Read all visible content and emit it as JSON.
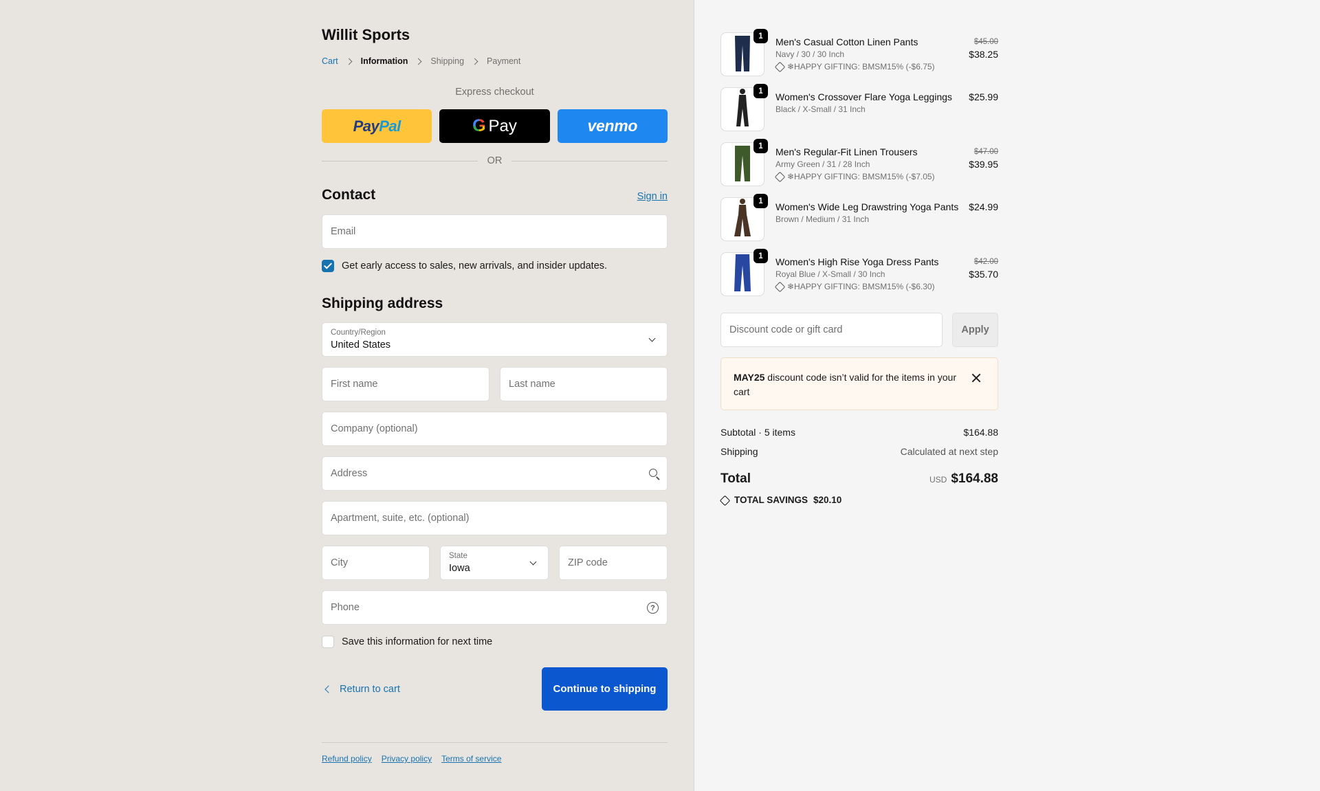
{
  "store": {
    "name": "Willit Sports"
  },
  "breadcrumb": [
    {
      "label": "Cart",
      "state": "link"
    },
    {
      "label": "Information",
      "state": "current"
    },
    {
      "label": "Shipping",
      "state": "upcoming"
    },
    {
      "label": "Payment",
      "state": "upcoming"
    }
  ],
  "express": {
    "label": "Express checkout",
    "buttons": [
      {
        "name": "paypal",
        "text_a": "Pay",
        "text_b": "Pal"
      },
      {
        "name": "gpay",
        "g": "G",
        "text": "Pay"
      },
      {
        "name": "venmo",
        "text": "venmo"
      }
    ],
    "or": "OR"
  },
  "contact": {
    "title": "Contact",
    "sign_in": "Sign in",
    "email_placeholder": "Email",
    "newsletter_label": "Get early access to sales, new arrivals, and insider updates.",
    "newsletter_checked": true
  },
  "shipping": {
    "title": "Shipping address",
    "country_label": "Country/Region",
    "country_value": "United States",
    "first_name": "First name",
    "last_name": "Last name",
    "company": "Company (optional)",
    "address": "Address",
    "apartment": "Apartment, suite, etc. (optional)",
    "city": "City",
    "state_label": "State",
    "state_value": "Iowa",
    "zip": "ZIP code",
    "phone": "Phone",
    "help_glyph": "?",
    "save_label": "Save this information for next time",
    "save_checked": false
  },
  "actions": {
    "return": "Return to cart",
    "continue": "Continue to shipping"
  },
  "footer": {
    "links": [
      "Refund policy",
      "Privacy policy",
      "Terms of service"
    ]
  },
  "cart": {
    "items": [
      {
        "name": "Men's Casual Cotton Linen Pants",
        "variant": "Navy / 30 / 30 Inch",
        "discount": "❄HAPPY GIFTING: BMSM15% (-$6.75)",
        "old_price": "$45.00",
        "price": "$38.25",
        "qty": "1",
        "color": "#1f2d4d"
      },
      {
        "name": "Women's Crossover Flare Yoga Leggings",
        "variant": "Black / X-Small / 31 Inch",
        "discount": "",
        "old_price": "",
        "price": "$25.99",
        "qty": "1",
        "color": "#222222"
      },
      {
        "name": "Men's Regular-Fit Linen Trousers",
        "variant": "Army Green / 31 / 28 Inch",
        "discount": "❄HAPPY GIFTING: BMSM15% (-$7.05)",
        "old_price": "$47.00",
        "price": "$39.95",
        "qty": "1",
        "color": "#3f5a2a"
      },
      {
        "name": "Women's Wide Leg Drawstring Yoga Pants",
        "variant": "Brown / Medium / 31 Inch",
        "discount": "",
        "old_price": "",
        "price": "$24.99",
        "qty": "1",
        "color": "#4a3426"
      },
      {
        "name": "Women's High Rise Yoga Dress Pants",
        "variant": "Royal Blue / X-Small / 30 Inch",
        "discount": "❄HAPPY GIFTING: BMSM15% (-$6.30)",
        "old_price": "$42.00",
        "price": "$35.70",
        "qty": "1",
        "color": "#2747a0"
      }
    ],
    "discount_placeholder": "Discount code or gift card",
    "apply": "Apply",
    "alert": {
      "code": "MAY25",
      "message": " discount code isn’t valid for the items in your cart"
    },
    "subtotal_label": "Subtotal · 5 items",
    "subtotal_value": "$164.88",
    "shipping_label": "Shipping",
    "shipping_value": "Calculated at next step",
    "total_label": "Total",
    "currency": "USD",
    "total_value": "$164.88",
    "savings_label": "TOTAL SAVINGS",
    "savings_value": "$20.10"
  },
  "colors": {
    "accent": "#1773b0",
    "primary_button": "#0b57d0",
    "paypal": "#ffc439",
    "venmo": "#1e88f0"
  }
}
